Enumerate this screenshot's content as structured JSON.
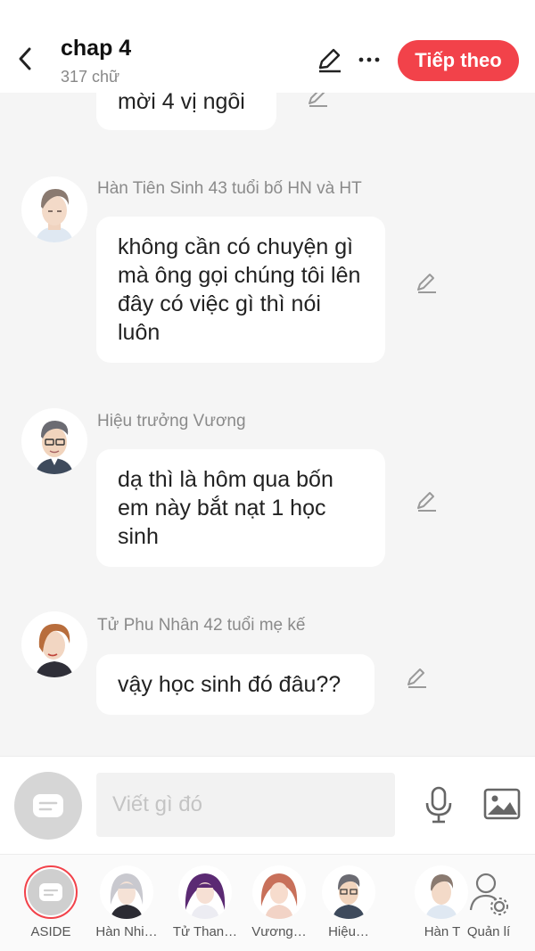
{
  "header": {
    "title": "chap 4",
    "subtitle": "317 chữ",
    "next_label": "Tiếp theo"
  },
  "messages": [
    {
      "speaker": "",
      "text": "mời 4 vị ngồi"
    },
    {
      "speaker": "Hàn Tiên Sinh 43 tuổi bố HN và HT",
      "text": "không cần có chuyện gì mà ông gọi chúng tôi lên đây có việc gì thì nói luôn"
    },
    {
      "speaker": "Hiệu trưởng Vương",
      "text": "dạ thì là hôm qua bốn em này bắt nạt 1 học sinh"
    },
    {
      "speaker": "Tử Phu Nhân 42 tuổi mẹ kế",
      "text": "vậy học sinh đó đâu??"
    }
  ],
  "composer": {
    "placeholder": "Viết gì đó",
    "value": ""
  },
  "characters": [
    {
      "label": "ASIDE",
      "icon": "aside-icon"
    },
    {
      "label": "Hàn Nhi…",
      "icon": "avatar-silver-hair"
    },
    {
      "label": "Tử Than…",
      "icon": "avatar-purple-hair"
    },
    {
      "label": "Vương…",
      "icon": "avatar-auburn-hair"
    },
    {
      "label": "Hiệu…",
      "icon": "avatar-principal"
    },
    {
      "label": "Hàn T",
      "icon": "avatar-han-tien-sinh"
    },
    {
      "label": "Quản lí",
      "icon": "user-settings-icon"
    }
  ],
  "colors": {
    "accent": "#f2424a",
    "background": "#f5f5f5",
    "bubble": "#ffffff",
    "muted_text": "#8a8a8a"
  }
}
